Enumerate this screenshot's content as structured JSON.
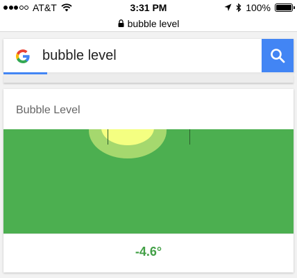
{
  "status_bar": {
    "signal_bars": 3,
    "signal_total": 5,
    "carrier": "AT&T",
    "time": "3:31 PM",
    "battery": "100%",
    "battery_level": 1.0,
    "icons": [
      "wifi-icon",
      "location-arrow-icon",
      "bluetooth-icon",
      "battery-icon"
    ]
  },
  "url_bar": {
    "url": "bubble level",
    "icon": "lock-icon"
  },
  "search": {
    "query": "bubble level",
    "logo_icon": "google-g-icon",
    "button_icon": "search-icon",
    "progress": 0.15,
    "colors": {
      "button": "#4285f4",
      "progress": "#4285f4"
    }
  },
  "level_card": {
    "title": "Bubble Level",
    "reading": "-4.6°",
    "tilt_degrees": -4.6,
    "colors": {
      "field": "#4caf50",
      "bubble": "#f4ff81",
      "halo": "#a5d86e",
      "reading": "#43a047"
    }
  }
}
